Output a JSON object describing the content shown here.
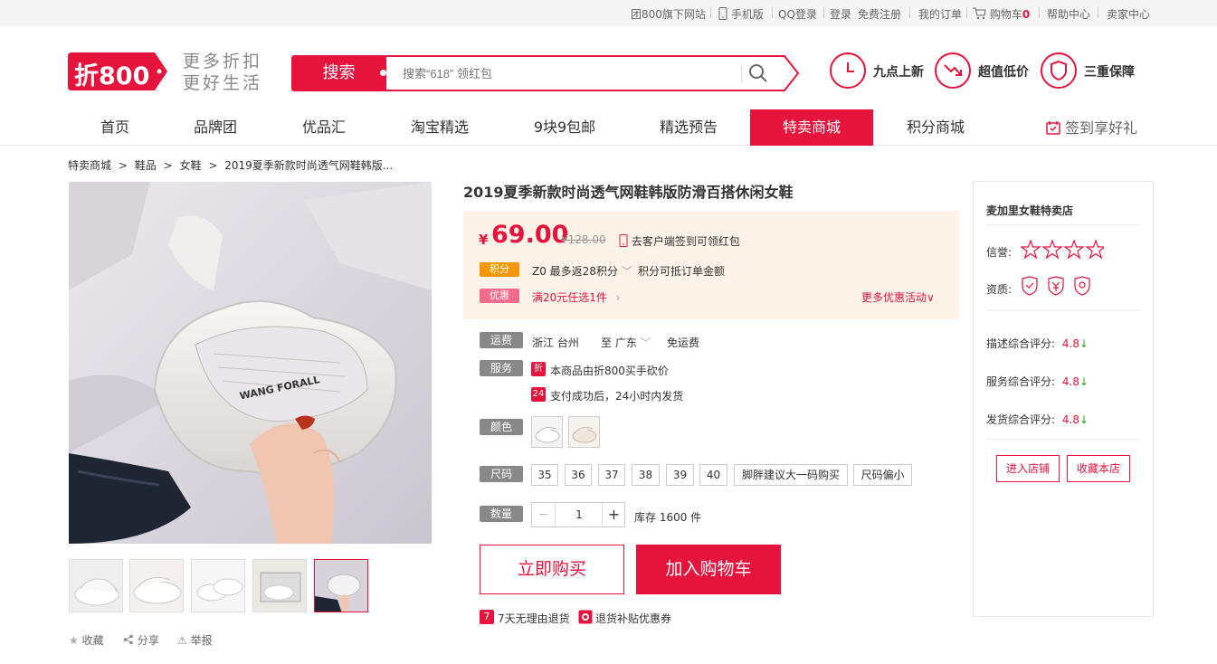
{
  "topbar": {
    "items": [
      "团800旗下网站",
      "手机版",
      "QQ登录",
      "登录",
      "免费注册",
      "我的订单",
      "购物车",
      "帮助中心",
      "卖家中心"
    ],
    "cart_count": "0"
  },
  "header": {
    "logo_text": "折800",
    "slogan_line1": "更多折扣",
    "slogan_line2": "更好生活",
    "search_button": "搜索",
    "search_placeholder": "搜索“618” 领红包",
    "services": [
      "九点上新",
      "超值低价",
      "三重保障"
    ]
  },
  "nav": {
    "items": [
      "首页",
      "品牌团",
      "优品汇",
      "淘宝精选",
      "9块9包邮",
      "精选预告",
      "特卖商城",
      "积分商城"
    ],
    "active": "特卖商城",
    "signin": "签到享好礼"
  },
  "breadcrumb": [
    "特卖商城",
    ">",
    "鞋品",
    ">",
    "女鞋",
    ">",
    "2019夏季新款时尚透气网鞋韩版..."
  ],
  "product": {
    "title": "2019夏季新款时尚透气网鞋韩版防滑百搭休闲女鞋",
    "price_symbol": "¥",
    "price": "69.00",
    "old_price": "¥128.00",
    "client_promo": "去客户端签到可领红包",
    "points_tag": "积分",
    "points_text": "Z0 最多返28积分",
    "points_note": "积分可抵订单金额",
    "discount_tag": "优惠",
    "discount_text": "满20元任选1件",
    "more_discount": "更多优惠活动",
    "shipping_label": "运费",
    "ship_from": "浙江 台州",
    "ship_to": "至 广东",
    "ship_fee": "免运费",
    "service_label": "服务",
    "service_badge1": "折",
    "service1": "本商品由折800买手砍价",
    "service_badge2": "24",
    "service2": "支付成功后，24小时内发货",
    "color_label": "颜色",
    "size_label": "尺码",
    "sizes": [
      "35",
      "36",
      "37",
      "38",
      "39",
      "40",
      "脚胖建议大一码购买",
      "尺码偏小"
    ],
    "qty_label": "数量",
    "qty_minus": "−",
    "qty_value": "1",
    "qty_plus": "+",
    "stock": "库存 1600 件",
    "buy_now": "立即购买",
    "add_cart": "加入购物车",
    "guarantee_badge": "7",
    "guarantee1": "7天无理由退货",
    "guarantee2": "退货补贴优惠券",
    "image_text": "WANG FORALL"
  },
  "tools": [
    "收藏",
    "分享",
    "举报"
  ],
  "shop": {
    "name": "麦加里女鞋特卖店",
    "credit_label": "信誉:",
    "qual_label": "资质:",
    "ratings": [
      {
        "label": "描述综合评分:",
        "value": "4.8"
      },
      {
        "label": "服务综合评分:",
        "value": "4.8"
      },
      {
        "label": "发货综合评分:",
        "value": "4.8"
      }
    ],
    "enter": "进入店铺",
    "collect": "收藏本店"
  },
  "colors": {
    "brand": "#e6133c",
    "orange": "#f39800",
    "pink": "#f26b8a",
    "green": "#2aa515"
  }
}
